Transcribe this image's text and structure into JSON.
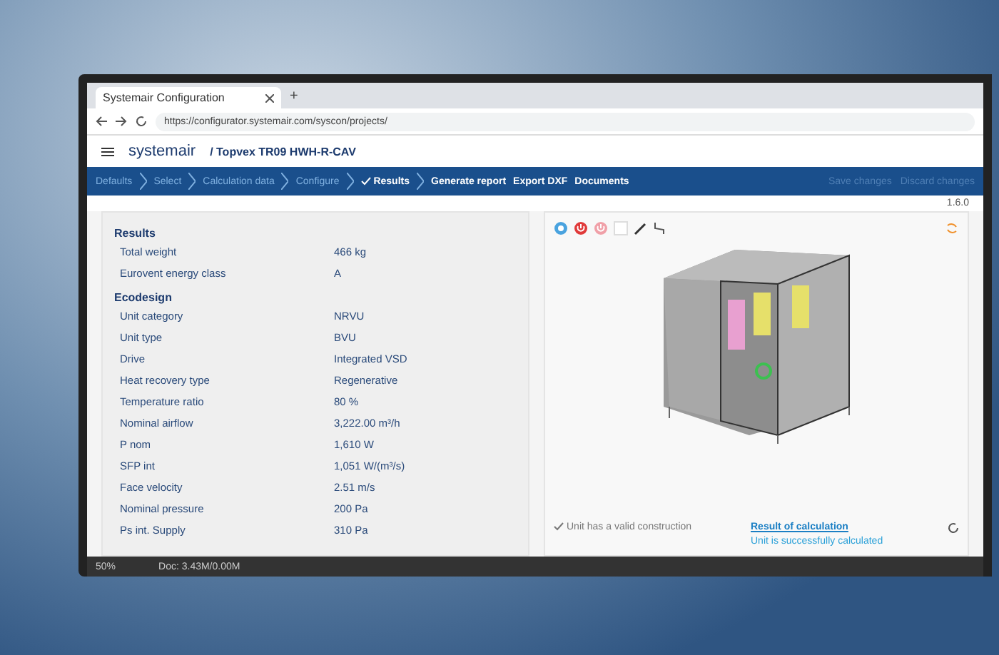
{
  "browser": {
    "tab_title": "Systemair Configuration",
    "new_tab": "+",
    "url": "https://configurator.systemair.com/syscon/projects/"
  },
  "app_header": {
    "logo": "systemair",
    "breadcrumb": "/ Topvex TR09 HWH-R-CAV"
  },
  "nav": [
    {
      "label": "Defaults",
      "kind": "step",
      "selected": false
    },
    {
      "label": "Select",
      "kind": "step",
      "selected": false
    },
    {
      "label": "Calculation data",
      "kind": "step",
      "selected": false
    },
    {
      "label": "Configure",
      "kind": "step",
      "selected": false
    },
    {
      "label": "Results",
      "kind": "step",
      "selected": true
    },
    {
      "label": "Generate report",
      "kind": "action"
    },
    {
      "label": "Export DXF",
      "kind": "action"
    },
    {
      "label": "Documents",
      "kind": "action"
    }
  ],
  "nav_right": [
    {
      "label": "Save changes",
      "disabled": true
    },
    {
      "label": "Discard changes",
      "disabled": true
    }
  ],
  "version": "1.6.0",
  "results": {
    "title": "Results",
    "rows": [
      {
        "label": "Total weight",
        "value": "466 kg"
      },
      {
        "label": "Eurovent energy class",
        "value": "A"
      }
    ]
  },
  "ecodesign": {
    "title": "Ecodesign",
    "rows": [
      {
        "label": "Unit category",
        "value": "NRVU"
      },
      {
        "label": "Unit type",
        "value": "BVU"
      },
      {
        "label": "Drive",
        "value": "Integrated VSD"
      },
      {
        "label": "Heat recovery type",
        "value": "Regenerative"
      },
      {
        "label": "Temperature ratio",
        "value": "80 %"
      },
      {
        "label": "Nominal airflow",
        "value": "3,222.00 m³/h"
      },
      {
        "label": "P nom",
        "value": "1,610 W"
      },
      {
        "label": "SFP int",
        "value": "1,051 W/(m³/s)"
      },
      {
        "label": "Face velocity",
        "value": "2.51 m/s"
      },
      {
        "label": "Nominal pressure",
        "value": "200 Pa"
      },
      {
        "label": "Ps int. Supply",
        "value": "310 Pa"
      }
    ]
  },
  "viewer": {
    "valid_note": "Unit has a valid construction",
    "result_link": "Result of calculation",
    "result_status": "Unit is successfully calculated"
  },
  "status_bar": {
    "zoom": "50%",
    "doc": "Doc: 3.43M/0.00M"
  }
}
